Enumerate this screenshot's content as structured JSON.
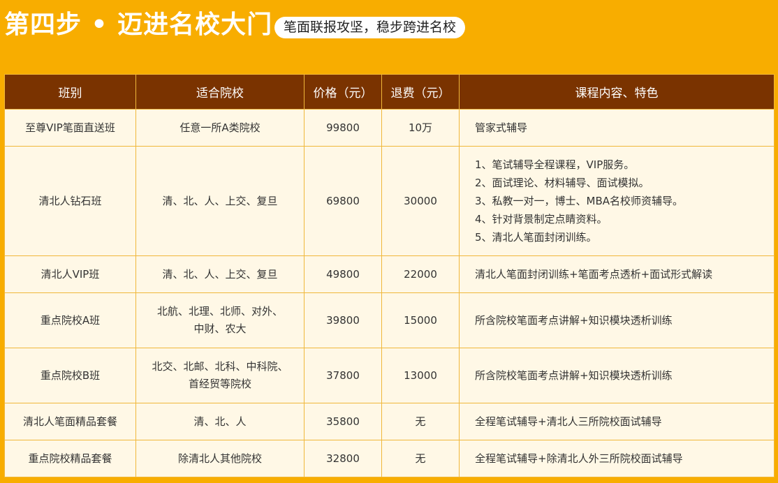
{
  "header": {
    "title": "第四步 • 迈进名校大门",
    "subtitle": "笔面联报攻坚，稳步跨进名校"
  },
  "colors": {
    "background": "#f8ad00",
    "table_header": "#7a3300",
    "cell_background": "#fff8e6",
    "border": "#f0b73a"
  },
  "table": {
    "headers": [
      "班别",
      "适合院校",
      "价格（元）",
      "退费（元）",
      "课程内容、特色"
    ],
    "rows": [
      {
        "class": "至尊VIP笔面直送班",
        "schools": [
          "任意一所A类院校"
        ],
        "price": "99800",
        "refund": "10万",
        "content": [
          "管家式辅导"
        ]
      },
      {
        "class": "清北人钻石班",
        "schools": [
          "清、北、人、上交、复旦"
        ],
        "price": "69800",
        "refund": "30000",
        "content": [
          "1、笔试辅导全程课程，VIP服务。",
          "2、面试理论、材料辅导、面试模拟。",
          "3、私教一对一，博士、MBA名校师资辅导。",
          "4、针对背景制定点睛资料。",
          "5、清北人笔面封闭训练。"
        ]
      },
      {
        "class": "清北人VIP班",
        "schools": [
          "清、北、人、上交、复旦"
        ],
        "price": "49800",
        "refund": "22000",
        "content": [
          "清北人笔面封闭训练+笔面考点透析+面试形式解读"
        ]
      },
      {
        "class": "重点院校A班",
        "schools": [
          "北航、北理、北师、对外、",
          "中财、农大"
        ],
        "price": "39800",
        "refund": "15000",
        "content": [
          "所含院校笔面考点讲解+知识模块透析训练"
        ]
      },
      {
        "class": "重点院校B班",
        "schools": [
          "北交、北邮、北科、中科院、",
          "首经贸等院校"
        ],
        "price": "37800",
        "refund": "13000",
        "content": [
          "所含院校笔面考点讲解+知识模块透析训练"
        ]
      },
      {
        "class": "清北人笔面精品套餐",
        "schools": [
          "清、北、人"
        ],
        "price": "35800",
        "refund": "无",
        "content": [
          "全程笔试辅导+清北人三所院校面试辅导"
        ]
      },
      {
        "class": "重点院校精品套餐",
        "schools": [
          "除清北人其他院校"
        ],
        "price": "32800",
        "refund": "无",
        "content": [
          "全程笔试辅导+除清北人外三所院校面试辅导"
        ]
      }
    ]
  }
}
